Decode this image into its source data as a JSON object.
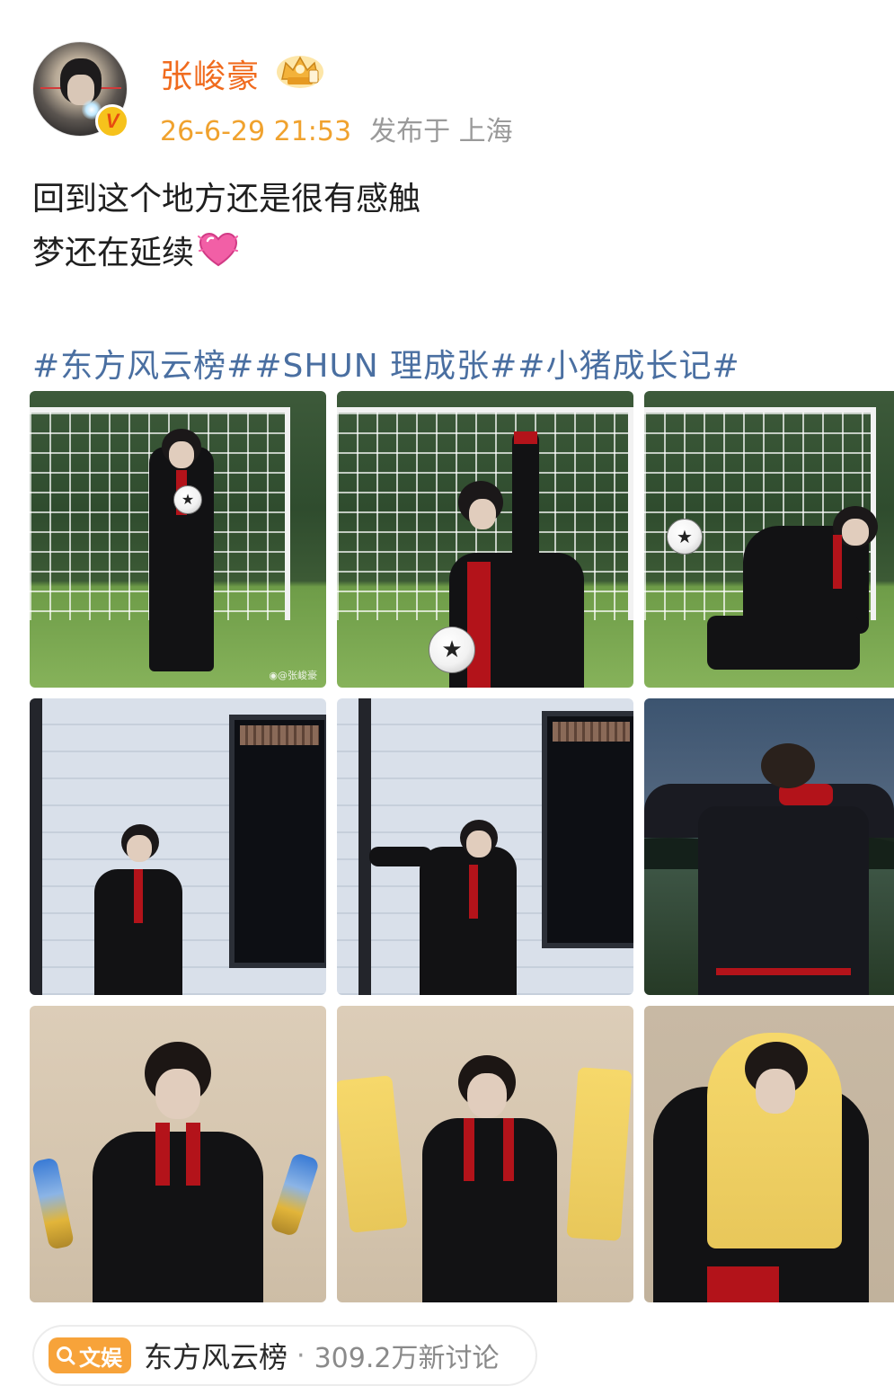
{
  "header": {
    "username": "张峻豪",
    "timestamp": "26-6-29 21:53",
    "location": "发布于 上海",
    "avatar_badge": "V",
    "avatar_badge_icon": "verified-v-icon",
    "rank_icon": "crown-icon"
  },
  "post": {
    "line1": "回到这个地方还是很有感触",
    "line2": "梦还在延续",
    "emoji_icon": "heart-icon",
    "hashtags": "#东方风云榜##SHUN 理成张##小猪成长记#"
  },
  "photos": {
    "watermark": "◉@张峻豪",
    "count": 9
  },
  "topic": {
    "tag_label": "文娱",
    "tag_icon": "search-icon",
    "name": "东方风云榜",
    "separator": "·",
    "discussions": "309.2万新讨论"
  },
  "colors": {
    "username": "#f06b1e",
    "timestamp": "#f0a22e",
    "hashtag": "#4a6fa1",
    "tag_bg": "#f7a33a"
  }
}
